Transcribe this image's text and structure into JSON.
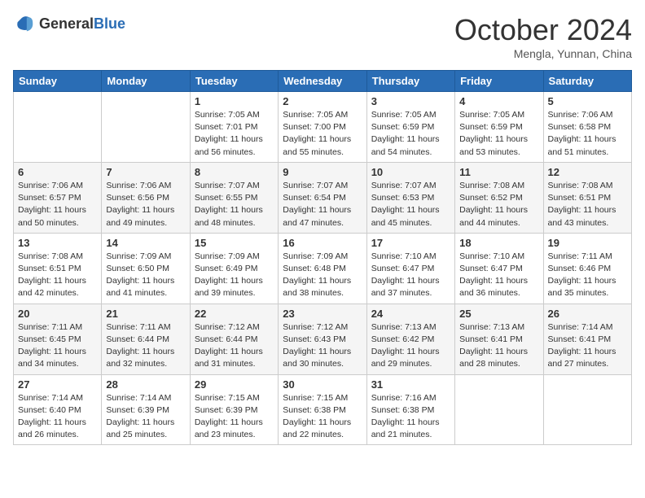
{
  "header": {
    "logo_general": "General",
    "logo_blue": "Blue",
    "month_title": "October 2024",
    "location": "Mengla, Yunnan, China"
  },
  "weekdays": [
    "Sunday",
    "Monday",
    "Tuesday",
    "Wednesday",
    "Thursday",
    "Friday",
    "Saturday"
  ],
  "rows": [
    [
      {
        "day": "",
        "sunrise": "",
        "sunset": "",
        "daylight": ""
      },
      {
        "day": "",
        "sunrise": "",
        "sunset": "",
        "daylight": ""
      },
      {
        "day": "1",
        "sunrise": "Sunrise: 7:05 AM",
        "sunset": "Sunset: 7:01 PM",
        "daylight": "Daylight: 11 hours and 56 minutes."
      },
      {
        "day": "2",
        "sunrise": "Sunrise: 7:05 AM",
        "sunset": "Sunset: 7:00 PM",
        "daylight": "Daylight: 11 hours and 55 minutes."
      },
      {
        "day": "3",
        "sunrise": "Sunrise: 7:05 AM",
        "sunset": "Sunset: 6:59 PM",
        "daylight": "Daylight: 11 hours and 54 minutes."
      },
      {
        "day": "4",
        "sunrise": "Sunrise: 7:05 AM",
        "sunset": "Sunset: 6:59 PM",
        "daylight": "Daylight: 11 hours and 53 minutes."
      },
      {
        "day": "5",
        "sunrise": "Sunrise: 7:06 AM",
        "sunset": "Sunset: 6:58 PM",
        "daylight": "Daylight: 11 hours and 51 minutes."
      }
    ],
    [
      {
        "day": "6",
        "sunrise": "Sunrise: 7:06 AM",
        "sunset": "Sunset: 6:57 PM",
        "daylight": "Daylight: 11 hours and 50 minutes."
      },
      {
        "day": "7",
        "sunrise": "Sunrise: 7:06 AM",
        "sunset": "Sunset: 6:56 PM",
        "daylight": "Daylight: 11 hours and 49 minutes."
      },
      {
        "day": "8",
        "sunrise": "Sunrise: 7:07 AM",
        "sunset": "Sunset: 6:55 PM",
        "daylight": "Daylight: 11 hours and 48 minutes."
      },
      {
        "day": "9",
        "sunrise": "Sunrise: 7:07 AM",
        "sunset": "Sunset: 6:54 PM",
        "daylight": "Daylight: 11 hours and 47 minutes."
      },
      {
        "day": "10",
        "sunrise": "Sunrise: 7:07 AM",
        "sunset": "Sunset: 6:53 PM",
        "daylight": "Daylight: 11 hours and 45 minutes."
      },
      {
        "day": "11",
        "sunrise": "Sunrise: 7:08 AM",
        "sunset": "Sunset: 6:52 PM",
        "daylight": "Daylight: 11 hours and 44 minutes."
      },
      {
        "day": "12",
        "sunrise": "Sunrise: 7:08 AM",
        "sunset": "Sunset: 6:51 PM",
        "daylight": "Daylight: 11 hours and 43 minutes."
      }
    ],
    [
      {
        "day": "13",
        "sunrise": "Sunrise: 7:08 AM",
        "sunset": "Sunset: 6:51 PM",
        "daylight": "Daylight: 11 hours and 42 minutes."
      },
      {
        "day": "14",
        "sunrise": "Sunrise: 7:09 AM",
        "sunset": "Sunset: 6:50 PM",
        "daylight": "Daylight: 11 hours and 41 minutes."
      },
      {
        "day": "15",
        "sunrise": "Sunrise: 7:09 AM",
        "sunset": "Sunset: 6:49 PM",
        "daylight": "Daylight: 11 hours and 39 minutes."
      },
      {
        "day": "16",
        "sunrise": "Sunrise: 7:09 AM",
        "sunset": "Sunset: 6:48 PM",
        "daylight": "Daylight: 11 hours and 38 minutes."
      },
      {
        "day": "17",
        "sunrise": "Sunrise: 7:10 AM",
        "sunset": "Sunset: 6:47 PM",
        "daylight": "Daylight: 11 hours and 37 minutes."
      },
      {
        "day": "18",
        "sunrise": "Sunrise: 7:10 AM",
        "sunset": "Sunset: 6:47 PM",
        "daylight": "Daylight: 11 hours and 36 minutes."
      },
      {
        "day": "19",
        "sunrise": "Sunrise: 7:11 AM",
        "sunset": "Sunset: 6:46 PM",
        "daylight": "Daylight: 11 hours and 35 minutes."
      }
    ],
    [
      {
        "day": "20",
        "sunrise": "Sunrise: 7:11 AM",
        "sunset": "Sunset: 6:45 PM",
        "daylight": "Daylight: 11 hours and 34 minutes."
      },
      {
        "day": "21",
        "sunrise": "Sunrise: 7:11 AM",
        "sunset": "Sunset: 6:44 PM",
        "daylight": "Daylight: 11 hours and 32 minutes."
      },
      {
        "day": "22",
        "sunrise": "Sunrise: 7:12 AM",
        "sunset": "Sunset: 6:44 PM",
        "daylight": "Daylight: 11 hours and 31 minutes."
      },
      {
        "day": "23",
        "sunrise": "Sunrise: 7:12 AM",
        "sunset": "Sunset: 6:43 PM",
        "daylight": "Daylight: 11 hours and 30 minutes."
      },
      {
        "day": "24",
        "sunrise": "Sunrise: 7:13 AM",
        "sunset": "Sunset: 6:42 PM",
        "daylight": "Daylight: 11 hours and 29 minutes."
      },
      {
        "day": "25",
        "sunrise": "Sunrise: 7:13 AM",
        "sunset": "Sunset: 6:41 PM",
        "daylight": "Daylight: 11 hours and 28 minutes."
      },
      {
        "day": "26",
        "sunrise": "Sunrise: 7:14 AM",
        "sunset": "Sunset: 6:41 PM",
        "daylight": "Daylight: 11 hours and 27 minutes."
      }
    ],
    [
      {
        "day": "27",
        "sunrise": "Sunrise: 7:14 AM",
        "sunset": "Sunset: 6:40 PM",
        "daylight": "Daylight: 11 hours and 26 minutes."
      },
      {
        "day": "28",
        "sunrise": "Sunrise: 7:14 AM",
        "sunset": "Sunset: 6:39 PM",
        "daylight": "Daylight: 11 hours and 25 minutes."
      },
      {
        "day": "29",
        "sunrise": "Sunrise: 7:15 AM",
        "sunset": "Sunset: 6:39 PM",
        "daylight": "Daylight: 11 hours and 23 minutes."
      },
      {
        "day": "30",
        "sunrise": "Sunrise: 7:15 AM",
        "sunset": "Sunset: 6:38 PM",
        "daylight": "Daylight: 11 hours and 22 minutes."
      },
      {
        "day": "31",
        "sunrise": "Sunrise: 7:16 AM",
        "sunset": "Sunset: 6:38 PM",
        "daylight": "Daylight: 11 hours and 21 minutes."
      },
      {
        "day": "",
        "sunrise": "",
        "sunset": "",
        "daylight": ""
      },
      {
        "day": "",
        "sunrise": "",
        "sunset": "",
        "daylight": ""
      }
    ]
  ]
}
